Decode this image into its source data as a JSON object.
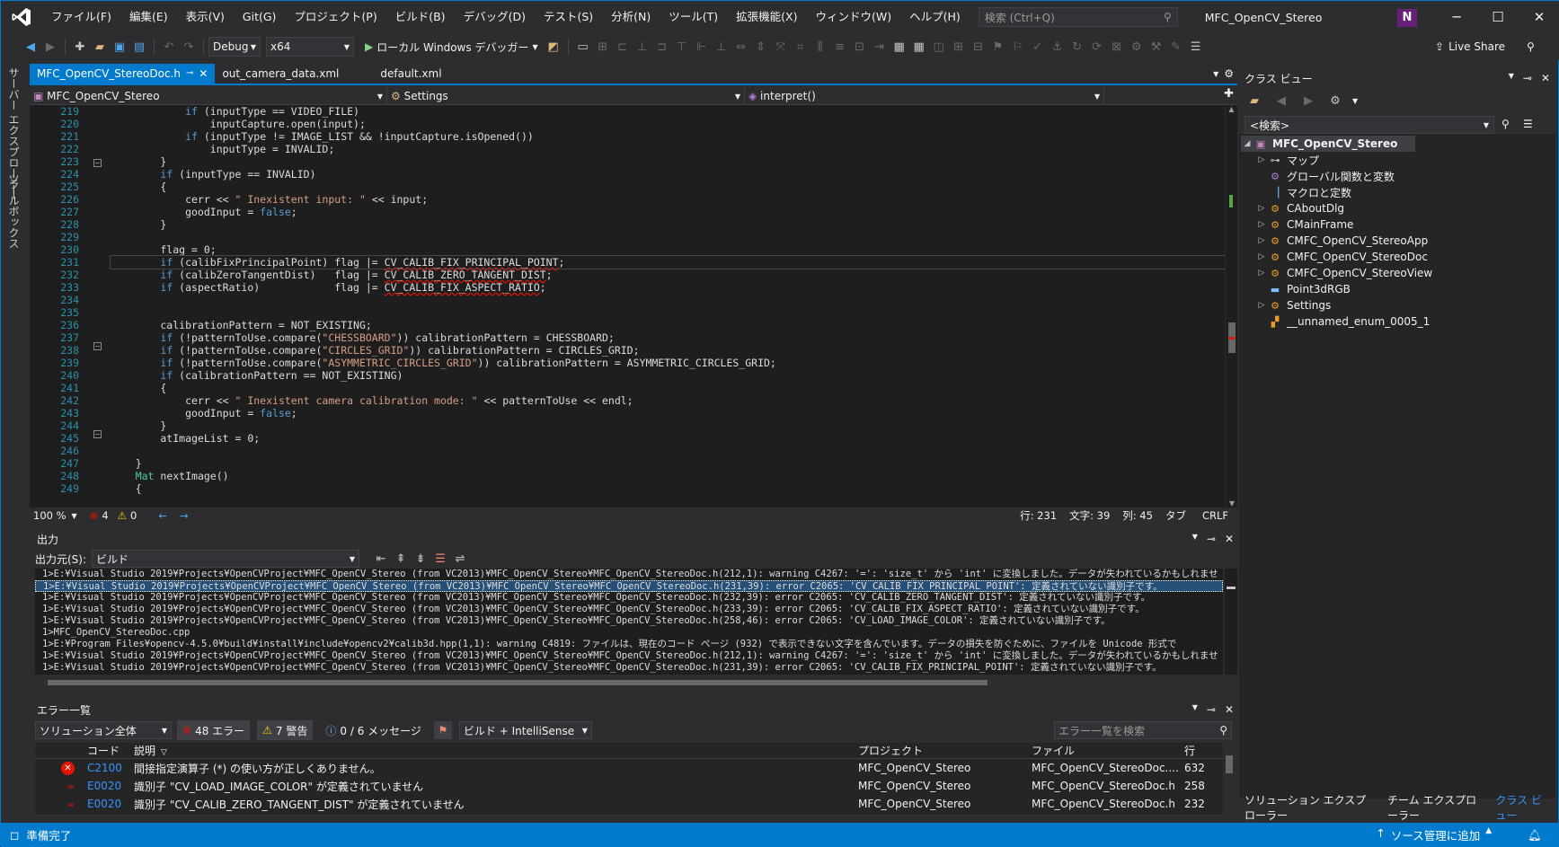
{
  "window": {
    "menu": [
      "ファイル(F)",
      "編集(E)",
      "表示(V)",
      "Git(G)",
      "プロジェクト(P)",
      "ビルド(B)",
      "デバッグ(D)",
      "テスト(S)",
      "分析(N)",
      "ツール(T)",
      "拡張機能(X)",
      "ウィンドウ(W)",
      "ヘルプ(H)"
    ],
    "search_placeholder": "検索 (Ctrl+Q)",
    "solution_title": "MFC_OpenCV_Stereo",
    "user_initial": "N"
  },
  "toolbar": {
    "config": "Debug",
    "platform": "x64",
    "debugger": "ローカル Windows デバッガー",
    "live_share": "Live Share"
  },
  "side_tabs": [
    "サーバー エクスプローラー",
    "ツールボックス"
  ],
  "editor": {
    "tabs": [
      {
        "label": "MFC_OpenCV_StereoDoc.h",
        "active": true
      },
      {
        "label": "out_camera_data.xml",
        "active": false
      },
      {
        "label": "default.xml",
        "active": false
      }
    ],
    "nav": {
      "project": "MFC_OpenCV_Stereo",
      "scope": "Settings",
      "member": "interpret()"
    },
    "line_numbers": [
      "219",
      "220",
      "221",
      "222",
      "223",
      "224",
      "225",
      "226",
      "227",
      "228",
      "229",
      "230",
      "231",
      "232",
      "233",
      "234",
      "235",
      "236",
      "237",
      "238",
      "239",
      "240",
      "241",
      "242",
      "243",
      "244",
      "245",
      "246",
      "247",
      "248",
      "249"
    ],
    "code_lines": [
      "            if (inputType == VIDEO_FILE)",
      "                inputCapture.open(input);",
      "            if (inputType != IMAGE_LIST && !inputCapture.isOpened())",
      "                inputType = INVALID;",
      "        }",
      "        if (inputType == INVALID)",
      "        {",
      "            cerr << \" Inexistent input: \" << input;",
      "            goodInput = false;",
      "        }",
      "",
      "        flag = 0;",
      "        if (calibFixPrincipalPoint) flag |= CV_CALIB_FIX_PRINCIPAL_POINT;",
      "        if (calibZeroTangentDist)   flag |= CV_CALIB_ZERO_TANGENT_DIST;",
      "        if (aspectRatio)            flag |= CV_CALIB_FIX_ASPECT_RATIO;",
      "",
      "",
      "        calibrationPattern = NOT_EXISTING;",
      "        if (!patternToUse.compare(\"CHESSBOARD\")) calibrationPattern = CHESSBOARD;",
      "        if (!patternToUse.compare(\"CIRCLES_GRID\")) calibrationPattern = CIRCLES_GRID;",
      "        if (!patternToUse.compare(\"ASYMMETRIC_CIRCLES_GRID\")) calibrationPattern = ASYMMETRIC_CIRCLES_GRID;",
      "        if (calibrationPattern == NOT_EXISTING)",
      "        {",
      "            cerr << \" Inexistent camera calibration mode: \" << patternToUse << endl;",
      "            goodInput = false;",
      "        }",
      "        atImageList = 0;",
      "",
      "    }",
      "    Mat nextImage()",
      "    {"
    ],
    "status": {
      "zoom": "100 %",
      "errors": "4",
      "warnings": "0",
      "line": "行: 231",
      "char": "文字: 39",
      "col": "列: 45",
      "tab": "タブ",
      "eol": "CRLF"
    }
  },
  "output": {
    "title": "出力",
    "source_label": "出力元(S):",
    "source": "ビルド",
    "lines": [
      "1>E:¥Visual Studio 2019¥Projects¥OpenCVProject¥MFC_OpenCV_Stereo (from VC2013)¥MFC_OpenCV_Stereo¥MFC_OpenCV_StereoDoc.h(212,1): warning C4267: '=': 'size_t' から 'int' に変換しました。データが失われているかもしれませ",
      "1>E:¥Visual Studio 2019¥Projects¥OpenCVProject¥MFC_OpenCV_Stereo (from VC2013)¥MFC_OpenCV_Stereo¥MFC_OpenCV_StereoDoc.h(231,39): error C2065: 'CV_CALIB_FIX_PRINCIPAL_POINT': 定義されていない識別子です。",
      "1>E:¥Visual Studio 2019¥Projects¥OpenCVProject¥MFC_OpenCV_Stereo (from VC2013)¥MFC_OpenCV_Stereo¥MFC_OpenCV_StereoDoc.h(232,39): error C2065: 'CV_CALIB_ZERO_TANGENT_DIST': 定義されていない識別子です。",
      "1>E:¥Visual Studio 2019¥Projects¥OpenCVProject¥MFC_OpenCV_Stereo (from VC2013)¥MFC_OpenCV_Stereo¥MFC_OpenCV_StereoDoc.h(233,39): error C2065: 'CV_CALIB_FIX_ASPECT_RATIO': 定義されていない識別子です。",
      "1>E:¥Visual Studio 2019¥Projects¥OpenCVProject¥MFC_OpenCV_Stereo (from VC2013)¥MFC_OpenCV_Stereo¥MFC_OpenCV_StereoDoc.h(258,46): error C2065: 'CV_LOAD_IMAGE_COLOR': 定義されていない識別子です。",
      "1>MFC_OpenCV_StereoDoc.cpp",
      "1>E:¥Program Files¥opencv-4.5.0¥build¥install¥include¥opencv2¥calib3d.hpp(1,1): warning C4819: ファイルは、現在のコード ページ (932) で表示できない文字を含んでいます。データの損失を防ぐために、ファイルを Unicode 形式で",
      "1>E:¥Visual Studio 2019¥Projects¥OpenCVProject¥MFC_OpenCV_Stereo (from VC2013)¥MFC_OpenCV_Stereo¥MFC_OpenCV_StereoDoc.h(212,1): warning C4267: '=': 'size_t' から 'int' に変換しました。データが失われているかもしれませ",
      "1>E:¥Visual Studio 2019¥Projects¥OpenCVProject¥MFC_OpenCV_Stereo (from VC2013)¥MFC_OpenCV_Stereo¥MFC_OpenCV_StereoDoc.h(231,39): error C2065: 'CV_CALIB_FIX_PRINCIPAL_POINT': 定義されていない識別子です。"
    ],
    "selected_line": 1
  },
  "error_list": {
    "title": "エラー一覧",
    "scope": "ソリューション全体",
    "errors_label": "48 エラー",
    "warnings_label": "7 警告",
    "messages_label": "0 / 6 メッセージ",
    "build_filter": "ビルド + IntelliSense",
    "search_placeholder": "エラー一覧を検索",
    "columns": [
      "コード",
      "説明",
      "プロジェクト",
      "ファイル",
      "行"
    ],
    "rows": [
      {
        "kind": "error",
        "code": "C2100",
        "desc": "間接指定演算子 (*) の使い方が正しくありません。",
        "project": "MFC_OpenCV_Stereo",
        "file": "MFC_OpenCV_StereoDoc....",
        "line": "632"
      },
      {
        "kind": "intellisense",
        "code": "E0020",
        "desc": "識別子 \"CV_LOAD_IMAGE_COLOR\" が定義されていません",
        "project": "MFC_OpenCV_Stereo",
        "file": "MFC_OpenCV_StereoDoc.h",
        "line": "258"
      },
      {
        "kind": "intellisense",
        "code": "E0020",
        "desc": "識別子 \"CV_CALIB_ZERO_TANGENT_DIST\" が定義されていません",
        "project": "MFC_OpenCV_Stereo",
        "file": "MFC_OpenCV_StereoDoc.h",
        "line": "232"
      }
    ]
  },
  "class_view": {
    "title": "クラス ビュー",
    "search": "<検索>",
    "root": "MFC_OpenCV_Stereo",
    "items": [
      {
        "label": "マップ",
        "icon": "map-icon",
        "expandable": true
      },
      {
        "label": "グローバル関数と変数",
        "icon": "globe-icon",
        "expandable": false
      },
      {
        "label": "マクロと定数",
        "icon": "macro-icon",
        "expandable": false
      },
      {
        "label": "CAboutDlg",
        "icon": "class-icon",
        "expandable": true
      },
      {
        "label": "CMainFrame",
        "icon": "class-icon",
        "expandable": true
      },
      {
        "label": "CMFC_OpenCV_StereoApp",
        "icon": "class-icon",
        "expandable": true
      },
      {
        "label": "CMFC_OpenCV_StereoDoc",
        "icon": "class-icon",
        "expandable": true
      },
      {
        "label": "CMFC_OpenCV_StereoView",
        "icon": "class-icon",
        "expandable": true
      },
      {
        "label": "Point3dRGB",
        "icon": "struct-icon",
        "expandable": false
      },
      {
        "label": "Settings",
        "icon": "class-icon",
        "expandable": true
      },
      {
        "label": "__unnamed_enum_0005_1",
        "icon": "enum-icon",
        "expandable": false
      }
    ],
    "bottom_tabs": [
      "ソリューション エクスプローラー",
      "チーム エクスプローラー",
      "クラス ビュー"
    ]
  },
  "statusbar": {
    "ready": "準備完了",
    "source_control": "ソース管理に追加"
  },
  "colors": {
    "accent": "#007acc",
    "error": "#e51400",
    "warning": "#ffcc00",
    "line_number": "#2b91af"
  }
}
